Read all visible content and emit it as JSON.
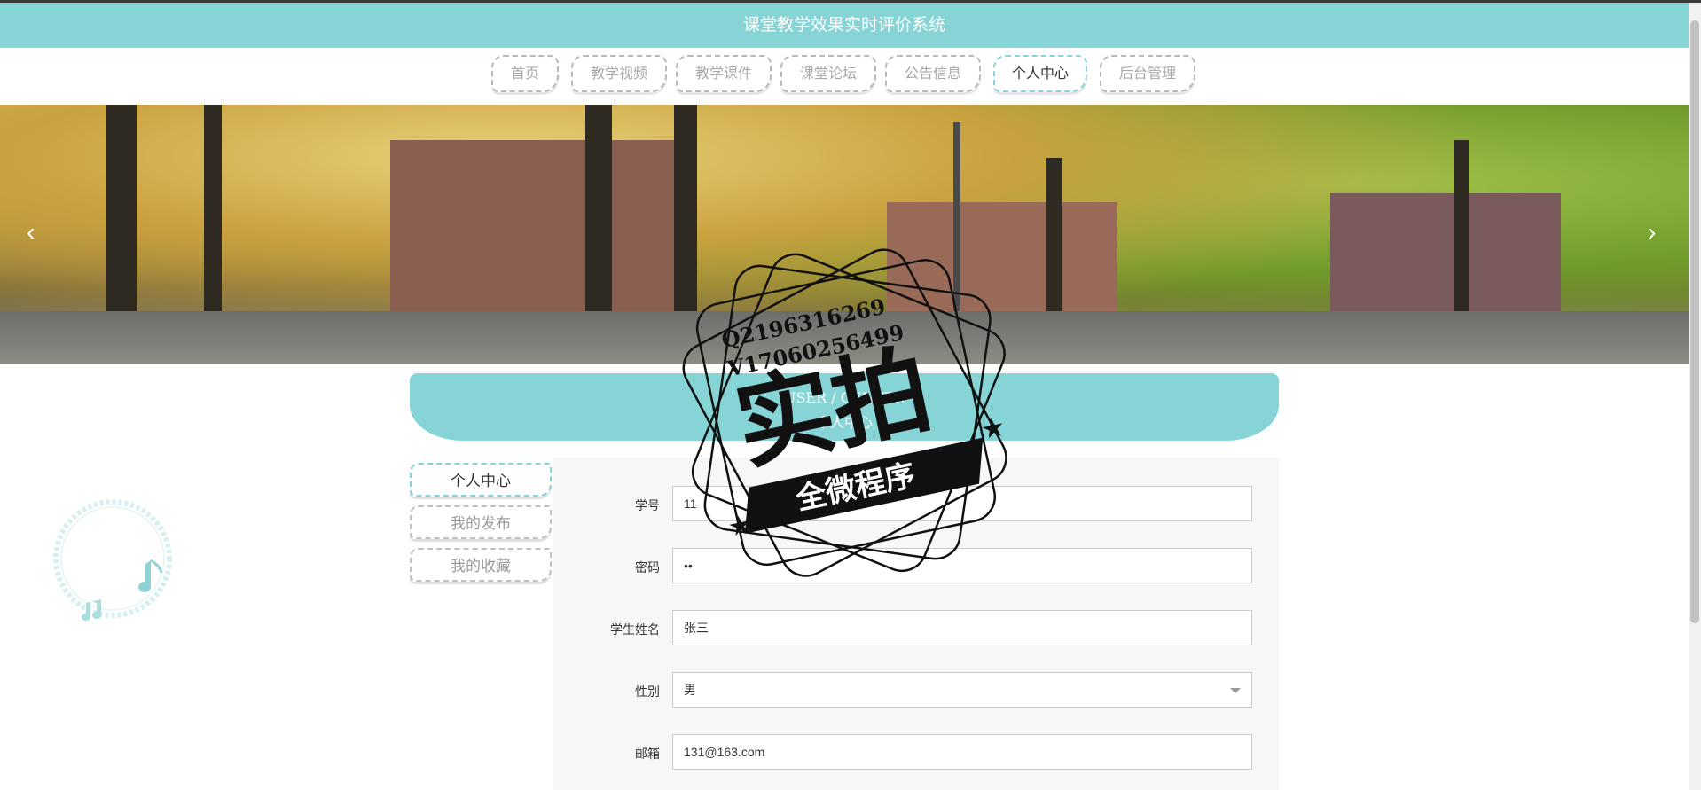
{
  "header": {
    "title": "课堂教学效果实时评价系统"
  },
  "nav": {
    "items": [
      {
        "label": "首页"
      },
      {
        "label": "教学视频"
      },
      {
        "label": "教学课件"
      },
      {
        "label": "课堂论坛"
      },
      {
        "label": "公告信息"
      },
      {
        "label": "个人中心"
      },
      {
        "label": "后台管理"
      }
    ],
    "active_index": 5
  },
  "banner": {
    "prev_glyph": "‹",
    "next_glyph": "›"
  },
  "section": {
    "title_en": "USER / CENTER",
    "title_cn": "个人中心"
  },
  "sidebar": {
    "items": [
      {
        "label": "个人中心"
      },
      {
        "label": "我的发布"
      },
      {
        "label": "我的收藏"
      }
    ]
  },
  "form": {
    "student_id": {
      "label": "学号",
      "value": "11"
    },
    "password": {
      "label": "密码",
      "value": "••"
    },
    "student_name": {
      "label": "学生姓名",
      "value": "张三"
    },
    "gender": {
      "label": "性别",
      "value": "男"
    },
    "email": {
      "label": "邮箱",
      "value": "131@163.com"
    }
  },
  "watermark": {
    "line1": "Q2196316269",
    "line2": "V17060256499",
    "main": "实拍",
    "ribbon": "全微程序"
  },
  "colors": {
    "accent": "#86d4d6",
    "border": "#c9c9c9"
  }
}
